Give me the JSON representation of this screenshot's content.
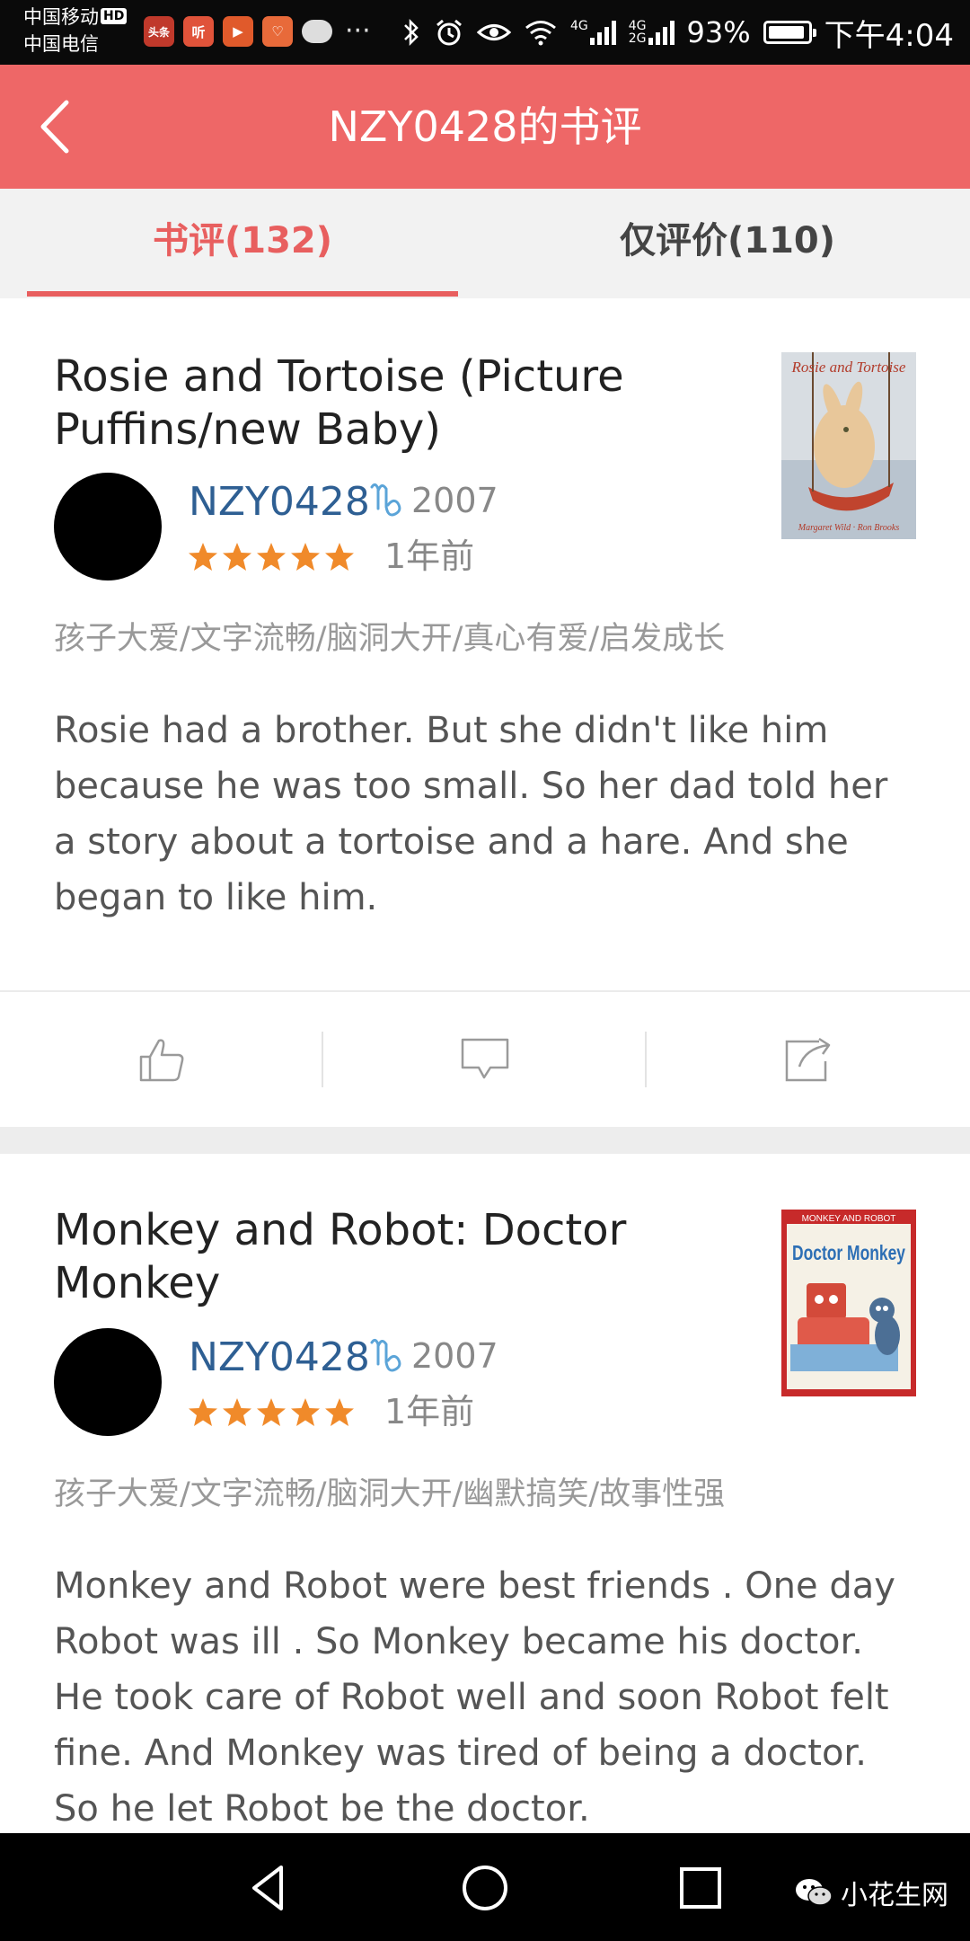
{
  "status_bar": {
    "carrier1": "中国移动",
    "hd": "HD",
    "carrier2": "中国电信",
    "notif": [
      "头条",
      "听",
      "▶",
      "♡"
    ],
    "net1": "4G",
    "net2a": "4G",
    "net2b": "2G",
    "battery": "93%",
    "battery_level": 0.93,
    "time": "下午4:04"
  },
  "header": {
    "title": "NZY0428的书评"
  },
  "tabs": [
    {
      "label": "书评(132)",
      "active": true
    },
    {
      "label": "仅评价(110)",
      "active": false
    }
  ],
  "reviews": [
    {
      "book_title": "Rosie and Tortoise (Picture Puffins/new Baby)",
      "cover_title": "Rosie and Tortoise",
      "cover_authors": "Margaret Wild · Ron Brooks",
      "username": "NZY0428",
      "birth_year": "2007",
      "rating": 5,
      "time": "1年前",
      "tags": "孩子大爱/文字流畅/脑洞大开/真心有爱/启发成长",
      "text": "Rosie had a brother. But she didn't like him because he was too small. So her dad told her a story about a tortoise and a hare. And she began to like him."
    },
    {
      "book_title": "Monkey and Robot: Doctor Monkey",
      "cover_series": "MONKEY AND ROBOT",
      "cover_title": "Doctor Monkey",
      "username": "NZY0428",
      "birth_year": "2007",
      "rating": 5,
      "time": "1年前",
      "tags": "孩子大爱/文字流畅/脑洞大开/幽默搞笑/故事性强",
      "text": "Monkey and Robot were best friends . One day Robot was ill . So Monkey became his doctor. He took care of Robot well and soon Robot felt fine. And Monkey was tired of being a doctor. So he let Robot be the doctor."
    }
  ],
  "watermark": "小花生网",
  "icons": {
    "back": "chevron-left-icon",
    "like": "thumbs-up-icon",
    "comment": "comment-icon",
    "share": "share-icon",
    "zodiac": "capricorn-icon",
    "star": "star-icon",
    "nav_back": "triangle-back-icon",
    "nav_home": "circle-home-icon",
    "nav_recent": "square-recent-icon",
    "watermark": "wechat-icon"
  },
  "colors": {
    "accent": "#ee6767",
    "tab_active": "#e85f5f",
    "username": "#2e5f93",
    "star": "#f08a2a"
  }
}
